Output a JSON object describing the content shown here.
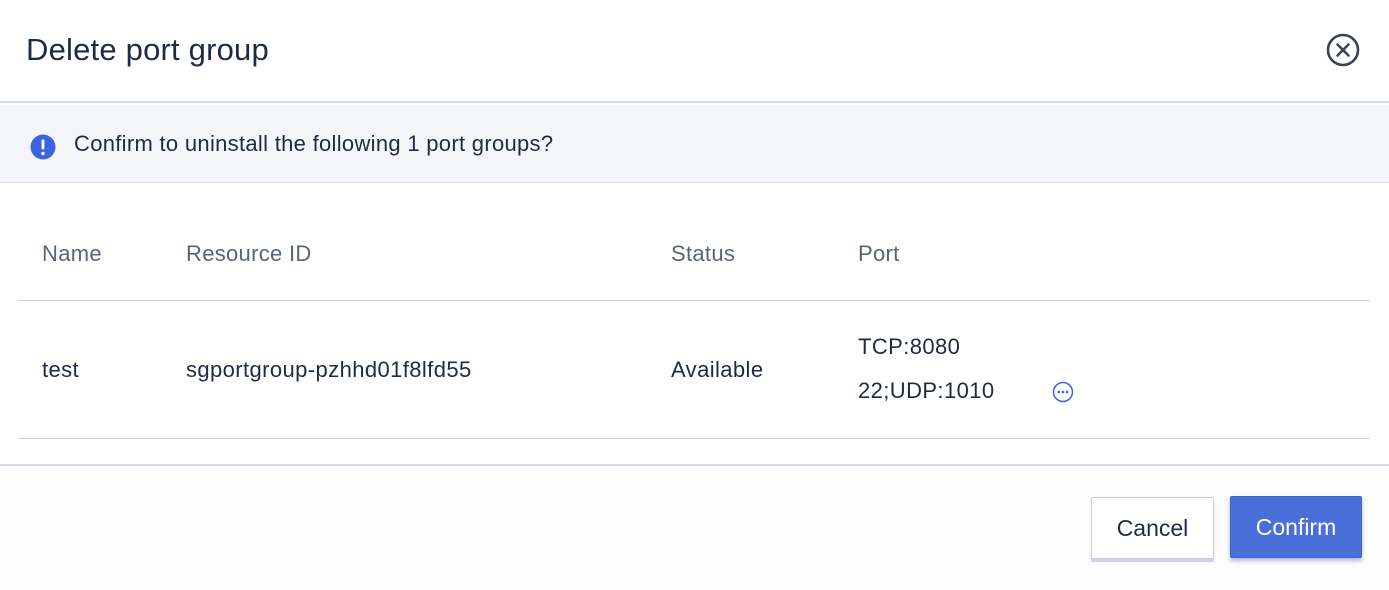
{
  "dialog": {
    "title": "Delete port group"
  },
  "notice": {
    "text": "Confirm to uninstall the following 1 port groups?",
    "icon": "info-icon",
    "icon_color": "#3d63e0"
  },
  "table": {
    "columns": [
      "Name",
      "Resource ID",
      "Status",
      "Port"
    ],
    "rows": [
      {
        "name": "test",
        "resource_id": "sgportgroup-pzhhd01f8lfd55",
        "status": "Available",
        "port_line1": "TCP:8080",
        "port_line2": "22;UDP:1010"
      }
    ]
  },
  "buttons": {
    "cancel": "Cancel",
    "confirm": "Confirm",
    "confirm_color": "#4b6fd9"
  }
}
